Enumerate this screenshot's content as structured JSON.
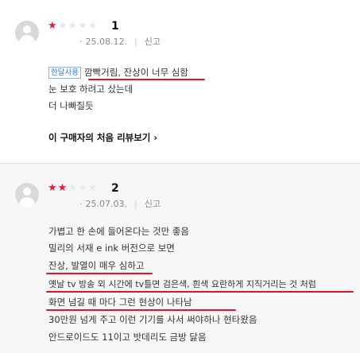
{
  "reviews": [
    {
      "rating": "1",
      "stars_filled": 1,
      "stars_total": 5,
      "date": "25.08.12.",
      "report": "신고",
      "option_tag": "한달사용",
      "headline": "깜빡거림, 잔상이 너무 심함",
      "lines": [
        "눈 보호 하려고 샀는데",
        "더 나빠질듯"
      ],
      "first_review_link": "이 구매자의 처음 리뷰보기",
      "first_review_arrow": "›"
    },
    {
      "rating": "2",
      "stars_filled": 2,
      "stars_total": 5,
      "date": "25.07.03.",
      "report": "신고",
      "lines": [
        "가볍고 한 손에 들어온다는 것만 좋음",
        "밀리의 서재 e ink 버전으로 보면",
        "잔상, 발열이 매우 심하고",
        "옛날 tv 방송 외 시간에 tv틀면 검은색, 흰색 요란하게 지직거리는 것 처럼",
        "화면 넘길 때 마다 그런 현상이 나타남",
        "30만원 넘게 주고 이런 기기를 사서 써야하나 현타왔음",
        "안드로이드도 11이고 밧데리도 금방 닳음"
      ]
    }
  ],
  "colors": {
    "star_on": "#f0172b",
    "star_off": "#e8e8e8",
    "underline": "#e8102a",
    "tag": "#3a78d4"
  },
  "icons": {
    "avatar": "default-user-avatar-icon",
    "star": "star-icon"
  }
}
